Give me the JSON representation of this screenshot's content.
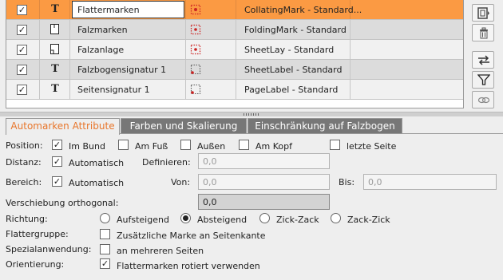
{
  "table": {
    "rows": [
      {
        "enabled": "✓",
        "type": "T",
        "name": "Flattermarken",
        "mark": "CollatingMark - Standard..."
      },
      {
        "enabled": "✓",
        "type": "doc",
        "name": "Falzmarken",
        "mark": "FoldingMark - Standard"
      },
      {
        "enabled": "✓",
        "type": "doc",
        "name": "Falzanlage",
        "mark": "SheetLay - Standard"
      },
      {
        "enabled": "✓",
        "type": "T",
        "name": "Falzbogensignatur 1",
        "mark": "SheetLabel - Standard"
      },
      {
        "enabled": "✓",
        "type": "T",
        "name": "Seitensignatur 1",
        "mark": "PageLabel - Standard"
      }
    ]
  },
  "tools": {
    "icons": [
      "frame-icon",
      "trash-icon",
      "swap-icon",
      "filter-icon",
      "link-icon"
    ]
  },
  "tabs": {
    "active": "Automarken Attribute",
    "tab1": "Farben und Skalierung",
    "tab2": "Einschränkung auf Falzbogen"
  },
  "form": {
    "position_label": "Position:",
    "im_bund": "Im Bund",
    "im_bund_checked": "✓",
    "am_fuss": "Am Fuß",
    "aussen": "Außen",
    "am_kopf": "Am Kopf",
    "letzte_seite": "letzte Seite",
    "distanz_label": "Distanz:",
    "distanz_auto": "Automatisch",
    "distanz_auto_checked": "✓",
    "definieren_label": "Definieren:",
    "definieren_value": "0,0",
    "bereich_label": "Bereich:",
    "bereich_auto": "Automatisch",
    "bereich_auto_checked": "✓",
    "von_label": "Von:",
    "von_value": "0,0",
    "bis_label": "Bis:",
    "bis_value": "0,0",
    "verschiebung_label": "Verschiebung orthogonal:",
    "verschiebung_value": "0,0",
    "richtung_label": "Richtung:",
    "aufsteigend": "Aufsteigend",
    "absteigend": "Absteigend",
    "zick_zack": "Zick-Zack",
    "zack_zick": "Zack-Zick",
    "flattergruppe_label": "Flattergruppe:",
    "zusaetzliche": "Zusätzliche Marke an Seitenkante",
    "spezial_label": "Spezialanwendung:",
    "mehreren": "an mehreren Seiten",
    "orientierung_label": "Orientierung:",
    "rotiert": "Flattermarken rotiert verwenden",
    "rotiert_checked": "✓"
  },
  "colors": {
    "selected_row": "#fb9a43",
    "active_tab_text": "#e8762b",
    "inactive_tab_bg": "#777777"
  }
}
